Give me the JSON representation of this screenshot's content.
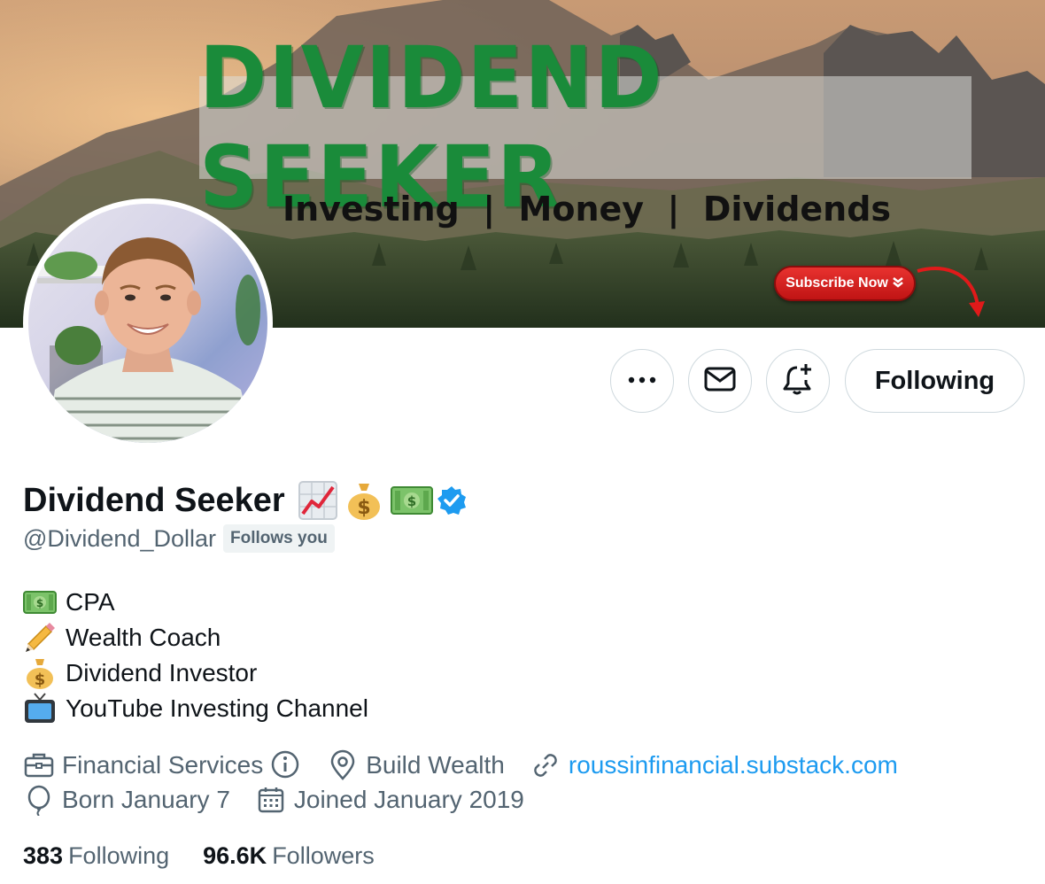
{
  "banner": {
    "title": "DIVIDEND SEEKER",
    "tagline": "Investing  |  Money  |  Dividends",
    "subscribe_label": "Subscribe Now"
  },
  "actions": {
    "more_icon": "more-horizontal-icon",
    "message_icon": "envelope-icon",
    "notify_icon": "bell-plus-icon",
    "following_label": "Following"
  },
  "profile": {
    "name": "Dividend Seeker",
    "name_emojis": [
      "chart-increasing-icon",
      "money-bag-icon",
      "dollar-banknote-icon"
    ],
    "verified_icon": "verified-badge-icon",
    "handle": "@Dividend_Dollar",
    "follows_you": "Follows you"
  },
  "bio": [
    {
      "icon": "dollar-banknote-icon",
      "text": "CPA"
    },
    {
      "icon": "pencil-icon",
      "text": "Wealth Coach"
    },
    {
      "icon": "money-bag-icon",
      "text": "Dividend Investor"
    },
    {
      "icon": "television-icon",
      "text": "YouTube Investing Channel"
    }
  ],
  "meta": {
    "category": "Financial Services",
    "location": "Build Wealth",
    "website": "roussinfinancial.substack.com",
    "birthday": "Born January 7",
    "joined": "Joined January 2019"
  },
  "stats": {
    "following_count": "383",
    "following_label": "Following",
    "followers_count": "96.6K",
    "followers_label": "Followers"
  },
  "colors": {
    "accent": "#1d9bf0",
    "banner_title": "#1a8b3a",
    "subscribe_red": "#d42020",
    "secondary_text": "#536471"
  }
}
